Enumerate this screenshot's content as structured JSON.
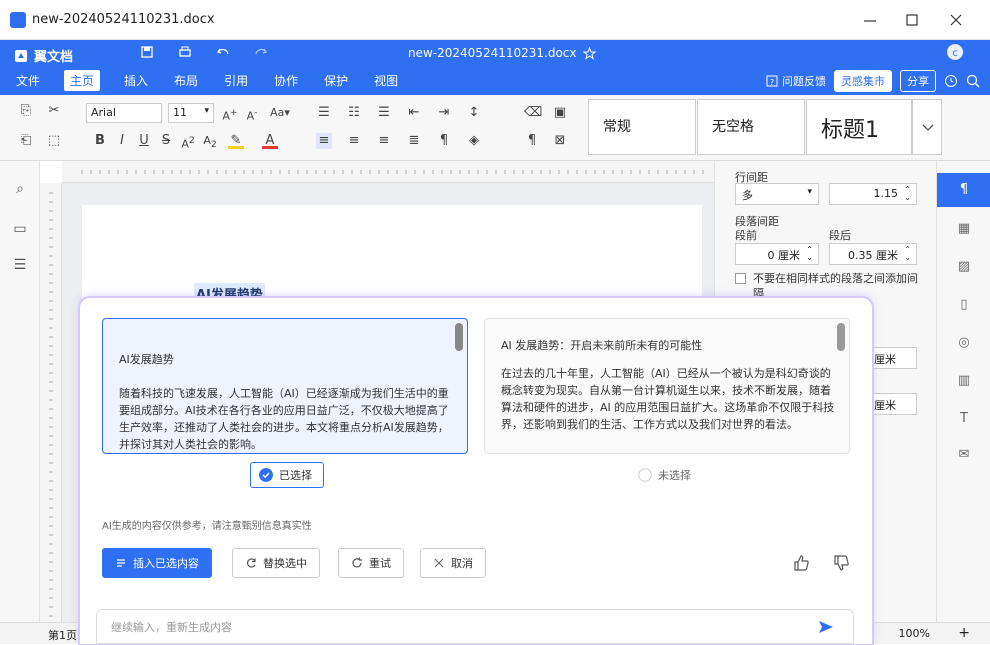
{
  "window": {
    "title": "new-20240524110231.docx"
  },
  "appbar": {
    "brand": "翼文档",
    "doc_title": "new-20240524110231.docx",
    "menu": [
      "文件",
      "主页",
      "插入",
      "布局",
      "引用",
      "协作",
      "保护",
      "视图"
    ],
    "active_menu": "主页",
    "feedback": "问题反馈",
    "market": "灵感集市",
    "share": "分享",
    "user_initial": "c"
  },
  "ribbon": {
    "font_name": "Arial",
    "font_size": "11",
    "styles": [
      "常规",
      "无空格",
      "标题1"
    ]
  },
  "document": {
    "heading": "AI发展趋势"
  },
  "right_panel": {
    "line_spacing_label": "行间距",
    "line_spacing_mode": "多",
    "line_spacing_value": "1.15",
    "paragraph_spacing_label": "段落间距",
    "before_label": "段前",
    "after_label": "段后",
    "before_value": "0 厘米",
    "after_value": "0.35 厘米",
    "no_space_same_style": "不要在相同样式的段落之间添加间隔",
    "partial_value_1": "厘米",
    "partial_value_2": "厘米"
  },
  "status": {
    "page": "第1页",
    "zoom": "100%"
  },
  "ai_dialog": {
    "option_a": {
      "title": "AI发展趋势",
      "body": "随着科技的飞速发展，人工智能（AI）已经逐渐成为我们生活中的重要组成部分。AI技术在各行各业的应用日益广泛，不仅极大地提高了生产效率，还推动了人类社会的进步。本文将重点分析AI发展趋势，并探讨其对人类社会的影响。",
      "status": "已选择"
    },
    "option_b": {
      "title": "AI 发展趋势：开启未来前所未有的可能性",
      "body": "在过去的几十年里，人工智能（AI）已经从一个被认为是科幻奇谈的概念转变为现实。自从第一台计算机诞生以来，技术不断发展，随着算法和硬件的进步，AI 的应用范围日益扩大。这场革命不仅限于科技界，还影响到我们的生活、工作方式以及我们对世界的看法。",
      "status": "未选择"
    },
    "disclaimer": "AI生成的内容仅供参考，请注意甄别信息真实性",
    "buttons": {
      "insert": "插入已选内容",
      "replace": "替换选中",
      "retry": "重试",
      "cancel": "取消"
    },
    "input_placeholder": "继续输入，重新生成内容"
  }
}
